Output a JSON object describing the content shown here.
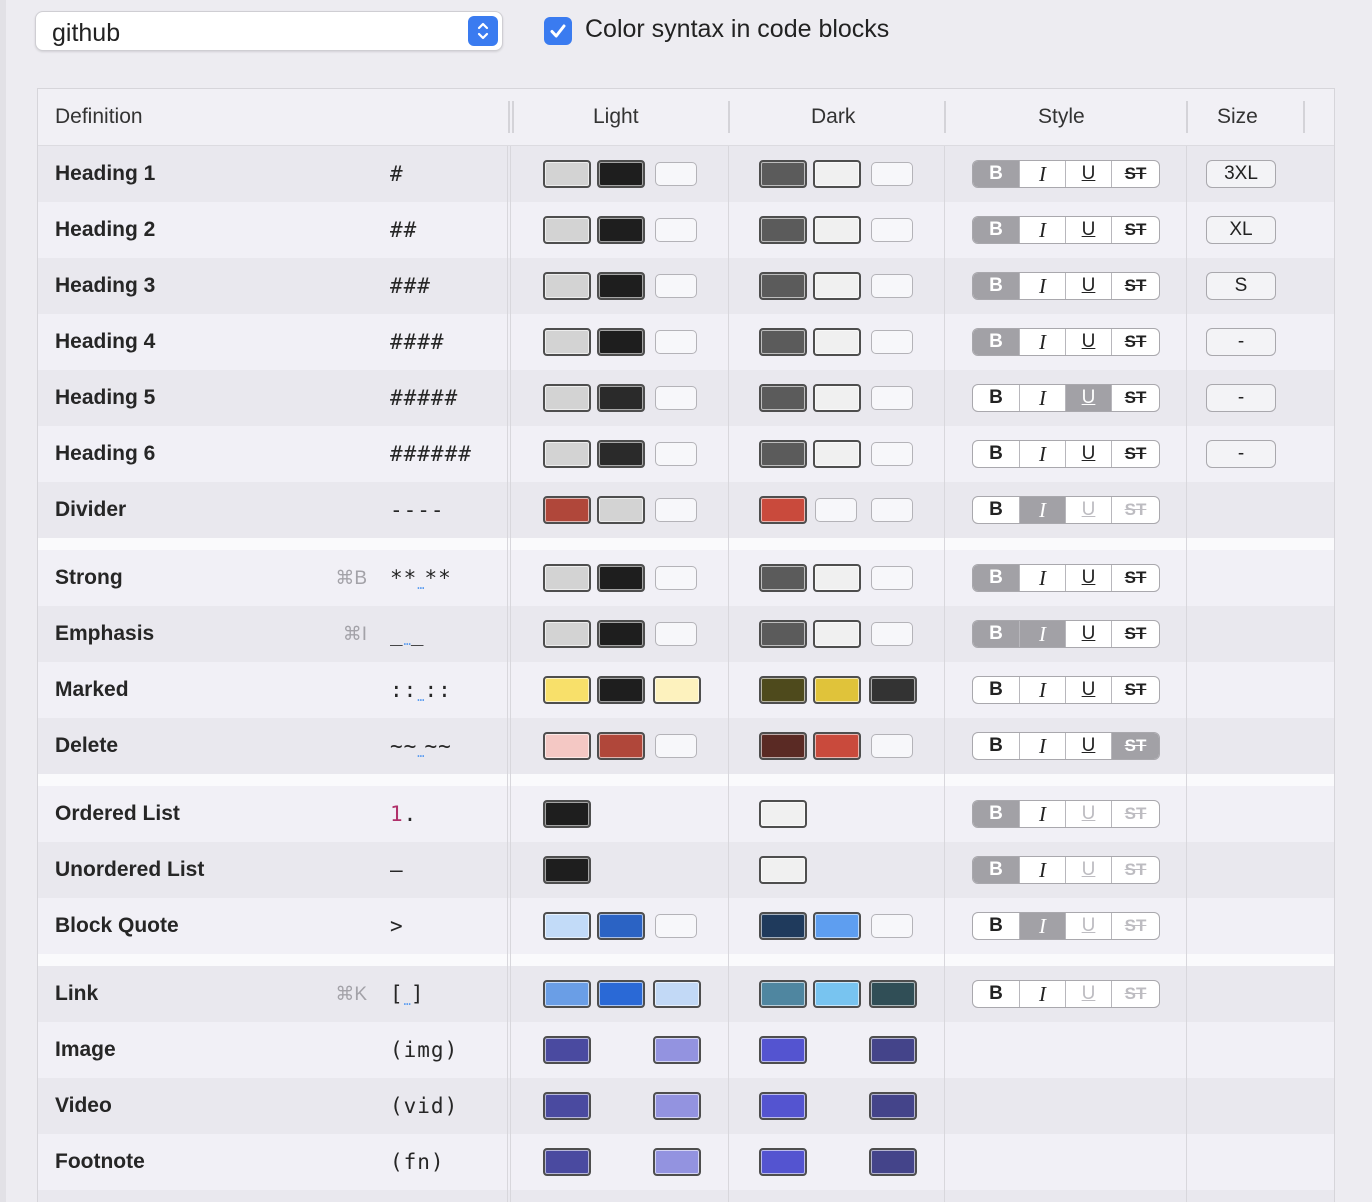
{
  "toolbar": {
    "theme_popup": "github",
    "color_syntax_label": "Color syntax in code blocks",
    "color_syntax_checked": true
  },
  "columns": {
    "definition": "Definition",
    "light": "Light",
    "dark": "Dark",
    "style": "Style",
    "size": "Size"
  },
  "rows": [
    {
      "name": "Heading 1",
      "shortcut": "",
      "syntax": "#",
      "light": [
        "#d3d3d3",
        "#1e1e1e",
        null
      ],
      "dark": [
        "#5b5b5b",
        "#f0f0f0",
        null
      ],
      "style": {
        "b": "on",
        "i": "off",
        "u": "off",
        "st": "off"
      },
      "size": "3XL"
    },
    {
      "name": "Heading 2",
      "shortcut": "",
      "syntax": "##",
      "light": [
        "#d3d3d3",
        "#1e1e1e",
        null
      ],
      "dark": [
        "#5b5b5b",
        "#f0f0f0",
        null
      ],
      "style": {
        "b": "on",
        "i": "off",
        "u": "off",
        "st": "off"
      },
      "size": "XL"
    },
    {
      "name": "Heading 3",
      "shortcut": "",
      "syntax": "###",
      "light": [
        "#d3d3d3",
        "#1e1e1e",
        null
      ],
      "dark": [
        "#5b5b5b",
        "#f0f0f0",
        null
      ],
      "style": {
        "b": "on",
        "i": "off",
        "u": "off",
        "st": "off"
      },
      "size": "S"
    },
    {
      "name": "Heading 4",
      "shortcut": "",
      "syntax": "####",
      "light": [
        "#d3d3d3",
        "#1e1e1e",
        null
      ],
      "dark": [
        "#5b5b5b",
        "#f0f0f0",
        null
      ],
      "style": {
        "b": "on",
        "i": "off",
        "u": "off",
        "st": "off"
      },
      "size": "-"
    },
    {
      "name": "Heading 5",
      "shortcut": "",
      "syntax": "#####",
      "light": [
        "#d3d3d3",
        "#2a2a2a",
        null
      ],
      "dark": [
        "#5b5b5b",
        "#f0f0f0",
        null
      ],
      "style": {
        "b": "off",
        "i": "off",
        "u": "on",
        "st": "off"
      },
      "size": "-"
    },
    {
      "name": "Heading 6",
      "shortcut": "",
      "syntax": "######",
      "light": [
        "#d3d3d3",
        "#2a2a2a",
        null
      ],
      "dark": [
        "#5b5b5b",
        "#f0f0f0",
        null
      ],
      "style": {
        "b": "off",
        "i": "off",
        "u": "off",
        "st": "off"
      },
      "size": "-"
    },
    {
      "name": "Divider",
      "shortcut": "",
      "syntax": "----",
      "light": [
        "#b0473a",
        "#d3d3d3",
        null
      ],
      "dark": [
        "#c94a3c",
        null,
        null
      ],
      "style": {
        "b": "off",
        "i": "on",
        "u": "dim",
        "st": "dim"
      },
      "size": ""
    },
    {
      "name": "Strong",
      "shortcut": "⌘B",
      "syntax": "**…**",
      "light": [
        "#d3d3d3",
        "#1e1e1e",
        null
      ],
      "dark": [
        "#5b5b5b",
        "#f0f0f0",
        null
      ],
      "style": {
        "b": "on",
        "i": "off",
        "u": "off",
        "st": "off"
      },
      "size": ""
    },
    {
      "name": "Emphasis",
      "shortcut": "⌘I",
      "syntax": "_…_",
      "light": [
        "#d3d3d3",
        "#1e1e1e",
        null
      ],
      "dark": [
        "#5b5b5b",
        "#f0f0f0",
        null
      ],
      "style": {
        "b": "on",
        "i": "on",
        "u": "off",
        "st": "off"
      },
      "size": ""
    },
    {
      "name": "Marked",
      "shortcut": "",
      "syntax": "::…::",
      "light": [
        "#f8e06a",
        "#1e1e1e",
        "#fdf2be"
      ],
      "dark": [
        "#4e4a1c",
        "#e0c33a",
        "#333333"
      ],
      "style": {
        "b": "off",
        "i": "off",
        "u": "off",
        "st": "off"
      },
      "size": ""
    },
    {
      "name": "Delete",
      "shortcut": "",
      "syntax": "~~…~~",
      "light": [
        "#f4c8c4",
        "#b0473a",
        null
      ],
      "dark": [
        "#5a2a24",
        "#c94a3c",
        null
      ],
      "style": {
        "b": "off",
        "i": "off",
        "u": "off",
        "st": "on"
      },
      "size": ""
    },
    {
      "name": "Ordered List",
      "shortcut": "",
      "syntax": "1.",
      "light": [
        "#1e1e1e"
      ],
      "dark": [
        "#f0f0f0"
      ],
      "style": {
        "b": "on",
        "i": "off",
        "u": "dim",
        "st": "dim"
      },
      "size": ""
    },
    {
      "name": "Unordered List",
      "shortcut": "",
      "syntax": "–",
      "light": [
        "#1e1e1e"
      ],
      "dark": [
        "#f0f0f0"
      ],
      "style": {
        "b": "on",
        "i": "off",
        "u": "dim",
        "st": "dim"
      },
      "size": ""
    },
    {
      "name": "Block Quote",
      "shortcut": "",
      "syntax": ">",
      "light": [
        "#c2dbf8",
        "#2b63c4",
        null
      ],
      "dark": [
        "#1f3a5c",
        "#5e9ef0",
        null
      ],
      "style": {
        "b": "off",
        "i": "on",
        "u": "dim",
        "st": "dim"
      },
      "size": ""
    },
    {
      "name": "Link",
      "shortcut": "⌘K",
      "syntax": "[…]",
      "light": [
        "#6a9ee6",
        "#2a69d6",
        "#c2d9f6"
      ],
      "dark": [
        "#4f86a0",
        "#78c4f0",
        "#304e56"
      ],
      "style": {
        "b": "off",
        "i": "off",
        "u": "dim",
        "st": "dim"
      },
      "size": ""
    },
    {
      "name": "Image",
      "shortcut": "",
      "syntax": "(img)",
      "light": [
        "#4a4aa0",
        "skip",
        "#9393e0"
      ],
      "dark": [
        "#5454d0",
        "skip",
        "#44448a"
      ],
      "style": null,
      "size": ""
    },
    {
      "name": "Video",
      "shortcut": "",
      "syntax": "(vid)",
      "light": [
        "#4a4aa0",
        "skip",
        "#9393e0"
      ],
      "dark": [
        "#5454d0",
        "skip",
        "#44448a"
      ],
      "style": null,
      "size": ""
    },
    {
      "name": "Footnote",
      "shortcut": "",
      "syntax": "(fn)",
      "light": [
        "#4a4aa0",
        "skip",
        "#9393e0"
      ],
      "dark": [
        "#5454d0",
        "skip",
        "#44448a"
      ],
      "style": null,
      "size": ""
    }
  ],
  "style_labels": {
    "b": "B",
    "i": "I",
    "u": "U",
    "st": "ST"
  }
}
